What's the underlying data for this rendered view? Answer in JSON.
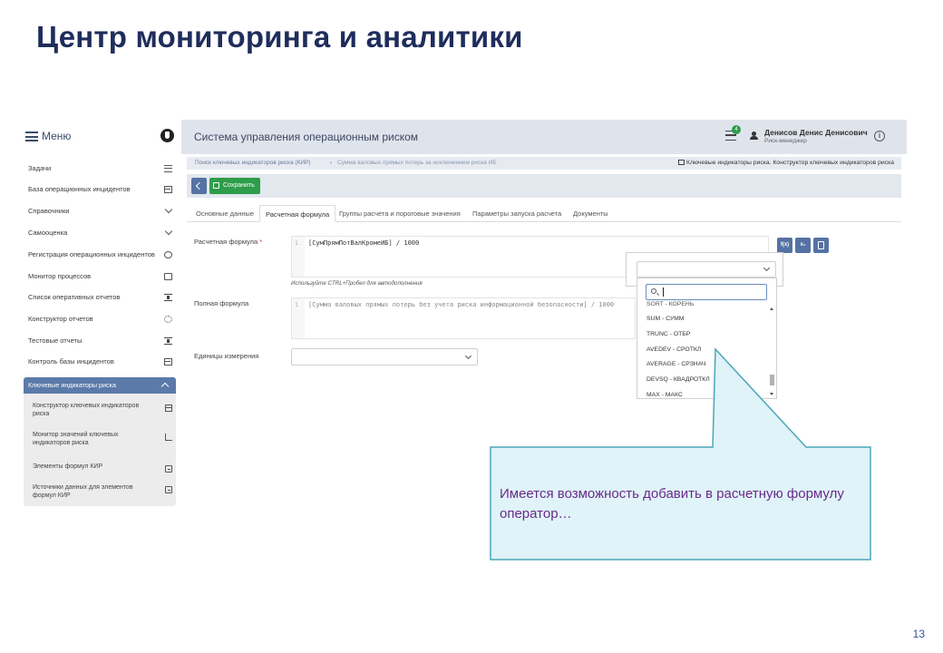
{
  "slide": {
    "title": "Центр мониторинга и аналитики",
    "page_number": "13"
  },
  "sidebar": {
    "menu_label": "Меню",
    "items": [
      {
        "label": "Задачи",
        "icon": "tasks-list-icon"
      },
      {
        "label": "База операционных инцидентов",
        "icon": "table-icon"
      },
      {
        "label": "Справочники",
        "icon": "chevron-down-icon"
      },
      {
        "label": "Самооценка",
        "icon": "chevron-down-icon"
      },
      {
        "label": "Регистрация операционных инцидентов",
        "icon": "registered-icon"
      },
      {
        "label": "Монитор процессов",
        "icon": "monitor-icon"
      },
      {
        "label": "Список оперативных отчетов",
        "icon": "hourglass-icon"
      },
      {
        "label": "Конструктор отчетов",
        "icon": "gears-icon"
      },
      {
        "label": "Тестовые отчеты",
        "icon": "hourglass-icon"
      },
      {
        "label": "Контроль базы инцидентов",
        "icon": "table-icon"
      }
    ],
    "kir_group": {
      "label": "Ключевые индикаторы риска",
      "items": [
        {
          "label": "Конструктор ключевых индикаторов риска",
          "icon": "table-icon"
        },
        {
          "label": "Монитор значений ключевых индикаторов риска",
          "icon": "area-chart-icon"
        },
        {
          "label": "Элементы формул КИР",
          "icon": "document-icon"
        },
        {
          "label": "Источники данных для элементов формул КИР",
          "icon": "document-icon"
        }
      ]
    }
  },
  "header": {
    "app_title": "Система управления операционным риском",
    "tasks_badge": "4",
    "user_name": "Денисов Денис Денисович",
    "user_role": "Риск-менеджер"
  },
  "breadcrumbs": {
    "first": "Поиск ключевых индикаторов риска (КИР)",
    "separator": "›",
    "second": "Сумма валовых прямых потерь за исключением риска ИБ",
    "right": "Ключевые индикаторы риска. Конструктор ключевых индикаторов риска"
  },
  "toolbar": {
    "save_label": "Сохранить"
  },
  "tabs": [
    {
      "label": "Основные данные"
    },
    {
      "label": "Расчетная формула"
    },
    {
      "label": "Группы расчета и пороговые значения"
    },
    {
      "label": "Параметры запуска расчета"
    },
    {
      "label": "Документы"
    }
  ],
  "form": {
    "calc_formula_label": "Расчетная формула",
    "required_mark": "*",
    "calc_formula_line": "1",
    "calc_formula_code": "[СумПрямПотВалКромеИБ] / 1000",
    "hint": "Используйте CTRL+Пробел для автодополнения",
    "full_formula_label": "Полная формула",
    "full_formula_line": "1",
    "full_formula_code": "[Сумма валовых прямых потерь без учета риска информационной безопасности] / 1000",
    "units_label": "Единицы измерения",
    "buttons": [
      "f(x)",
      "x₁",
      "calc"
    ]
  },
  "function_dropdown": {
    "cut_item": "SQRT - КОРЕНЬ",
    "items": [
      "SUM - СУММ",
      "TRUNC - ОТБР",
      "AVEDEV - СРОТКЛ",
      "AVERAGE - СРЗНАЧ",
      "DEVSQ - КВАДРОТКЛ",
      "MAX - МАКС"
    ]
  },
  "callout": {
    "text": "Имеется возможность добавить в расчетную формулу оператор…",
    "fill": "#dff3f8",
    "stroke": "#4aa6b8",
    "text_color": "#6a2a8a"
  }
}
